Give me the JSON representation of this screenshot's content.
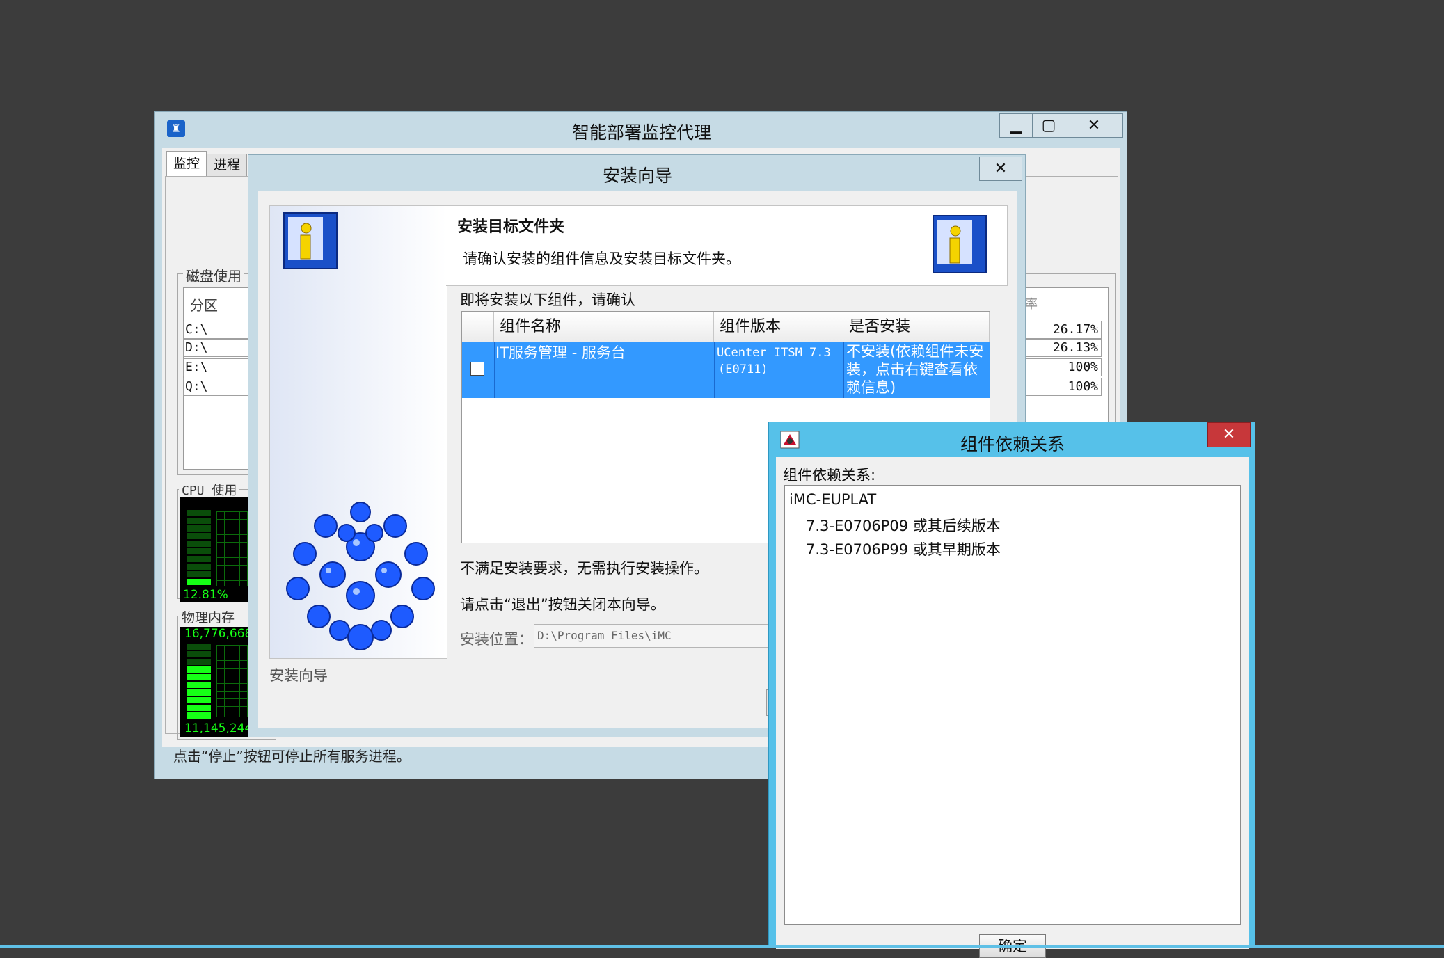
{
  "main_window": {
    "title": "智能部署监控代理",
    "tabs": [
      "监控",
      "进程"
    ],
    "disk_group_label": "磁盘使用",
    "disk_header": "分区",
    "disk_rate_header": "率",
    "partitions": [
      "C:\\",
      "D:\\",
      "E:\\",
      "Q:\\"
    ],
    "usage": [
      "26.17%",
      "26.13%",
      "100%",
      "100%"
    ],
    "cpu_group_label": "CPU 使用",
    "cpu_value": "12.81%",
    "cpu_level": 0.13,
    "mem_group_label": "物理内存",
    "mem_top_value": "16,776,668",
    "mem_bottom_value": "11,145,244",
    "mem_level": 0.66,
    "status_text": "点击“停止”按钮可停止所有服务进程。"
  },
  "wizard": {
    "title": "安装向导",
    "heading": "安装目标文件夹",
    "subheading": "请确认安装的组件信息及安装目标文件夹。",
    "list_label": "即将安装以下组件，请确认",
    "columns": [
      "组件名称",
      "组件版本",
      "是否安装"
    ],
    "row": {
      "name": "IT服务管理 - 服务台",
      "version_line1": "UCenter ITSM 7.3",
      "version_line2": "(E0711)",
      "status_line1": "不安装(依赖组件未安",
      "status_line2": "装，点击右键查看依",
      "status_line3": "赖信息)"
    },
    "msg1": "不满足安装要求，无需执行安装操作。",
    "msg2": "请点击“退出”按钮关闭本向导。",
    "location_label": "安装位置：",
    "location_value": "D:\\Program Files\\iMC",
    "footer_label": "安装向导"
  },
  "deps": {
    "title": "组件依赖关系",
    "label": "组件依赖关系:",
    "lines": [
      "iMC-EUPLAT",
      "7.3-E0706P09 或其后续版本",
      "7.3-E0706P99 或其早期版本"
    ],
    "ok_label": "确定"
  },
  "colors": {
    "desktop": "#3c3c3c",
    "titlebar": "#c6dbe5",
    "selection": "#3399ff",
    "deps_frame": "#56c1e9"
  }
}
